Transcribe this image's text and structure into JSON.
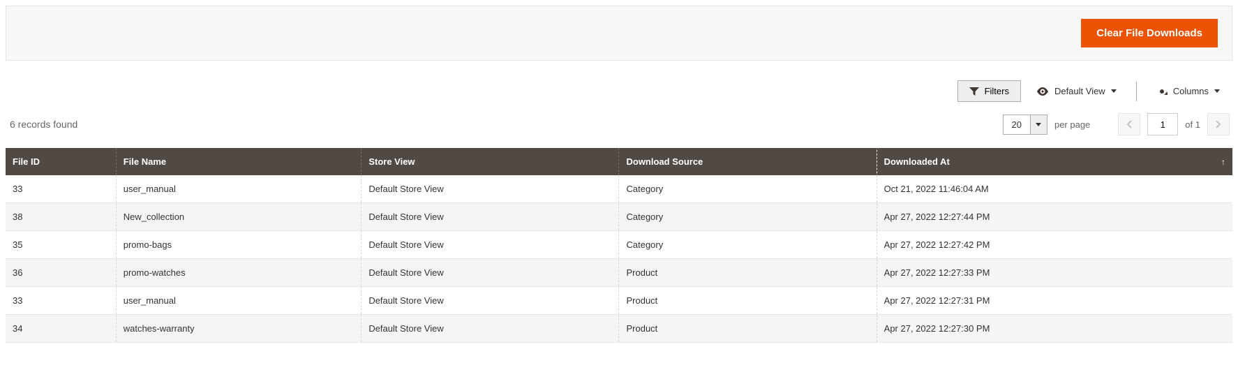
{
  "header": {
    "clear_button": "Clear File Downloads"
  },
  "toolbar": {
    "filters_label": "Filters",
    "default_view_label": "Default View",
    "columns_label": "Columns"
  },
  "pager": {
    "records_found": "6 records found",
    "per_page_value": "20",
    "per_page_label": "per page",
    "current_page": "1",
    "of_label": "of",
    "total_pages": "1"
  },
  "table": {
    "columns": [
      {
        "label": "File ID"
      },
      {
        "label": "File Name"
      },
      {
        "label": "Store View"
      },
      {
        "label": "Download Source"
      },
      {
        "label": "Downloaded At",
        "sorted": "asc"
      }
    ],
    "rows": [
      {
        "file_id": "33",
        "file_name": "user_manual",
        "store_view": "Default Store View",
        "download_source": "Category",
        "downloaded_at": "Oct 21, 2022 11:46:04 AM"
      },
      {
        "file_id": "38",
        "file_name": "New_collection",
        "store_view": "Default Store View",
        "download_source": "Category",
        "downloaded_at": "Apr 27, 2022 12:27:44 PM"
      },
      {
        "file_id": "35",
        "file_name": "promo-bags",
        "store_view": "Default Store View",
        "download_source": "Category",
        "downloaded_at": "Apr 27, 2022 12:27:42 PM"
      },
      {
        "file_id": "36",
        "file_name": "promo-watches",
        "store_view": "Default Store View",
        "download_source": "Product",
        "downloaded_at": "Apr 27, 2022 12:27:33 PM"
      },
      {
        "file_id": "33",
        "file_name": "user_manual",
        "store_view": "Default Store View",
        "download_source": "Product",
        "downloaded_at": "Apr 27, 2022 12:27:31 PM"
      },
      {
        "file_id": "34",
        "file_name": "watches-warranty",
        "store_view": "Default Store View",
        "download_source": "Product",
        "downloaded_at": "Apr 27, 2022 12:27:30 PM"
      }
    ]
  }
}
